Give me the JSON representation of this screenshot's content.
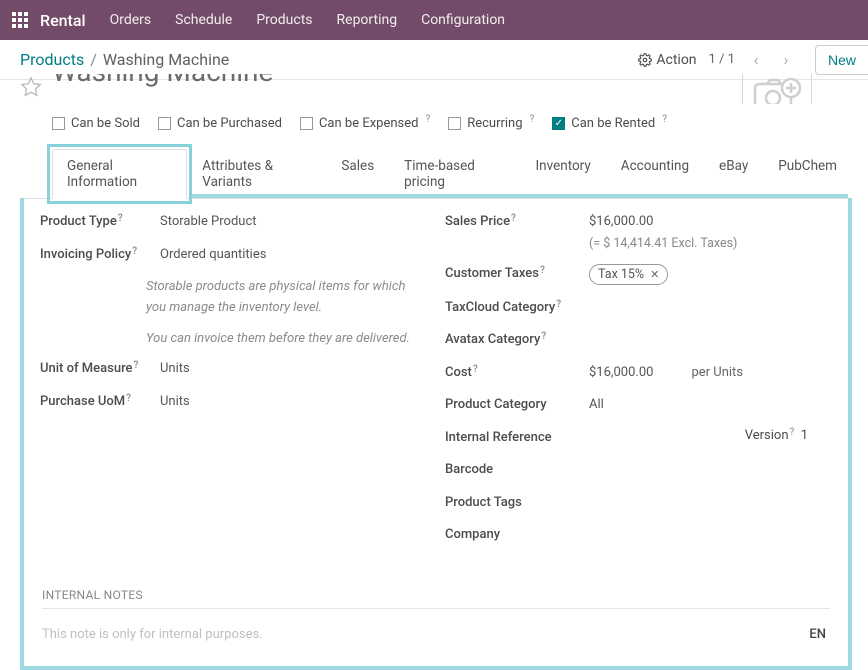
{
  "nav": {
    "brand": "Rental",
    "items": [
      "Orders",
      "Schedule",
      "Products",
      "Reporting",
      "Configuration"
    ]
  },
  "breadcrumb": {
    "root": "Products",
    "current": "Washing Machine"
  },
  "controls": {
    "action": "Action",
    "pager": "1 / 1",
    "new": "New"
  },
  "title": "Washing Machine",
  "checks": {
    "sold": "Can be Sold",
    "purchased": "Can be Purchased",
    "expensed": "Can be Expensed",
    "recurring": "Recurring",
    "rented": "Can be Rented"
  },
  "tabs": [
    "General Information",
    "Attributes & Variants",
    "Sales",
    "Time-based pricing",
    "Inventory",
    "Accounting",
    "eBay",
    "PubChem"
  ],
  "left": {
    "product_type_label": "Product Type",
    "product_type": "Storable Product",
    "invoicing_label": "Invoicing Policy",
    "invoicing": "Ordered quantities",
    "help1": "Storable products are physical items for which you manage the inventory level.",
    "help2": "You can invoice them before they are delivered.",
    "uom_label": "Unit of Measure",
    "uom": "Units",
    "puom_label": "Purchase UoM",
    "puom": "Units"
  },
  "right": {
    "sales_price_label": "Sales Price",
    "sales_price": "$16,000.00",
    "sales_price_excl": "(= $ 14,414.41 Excl. Taxes)",
    "cust_taxes_label": "Customer Taxes",
    "cust_taxes_tag": "Tax 15%",
    "taxcloud_label": "TaxCloud Category",
    "avatax_label": "Avatax Category",
    "cost_label": "Cost",
    "cost": "$16,000.00",
    "cost_unit": "per Units",
    "prodcat_label": "Product Category",
    "prodcat": "All",
    "intref_label": "Internal Reference",
    "version_label": "Version",
    "version": "1",
    "barcode_label": "Barcode",
    "tags_label": "Product Tags",
    "company_label": "Company"
  },
  "notes": {
    "section": "INTERNAL NOTES",
    "placeholder": "This note is only for internal purposes.",
    "lang": "EN"
  }
}
